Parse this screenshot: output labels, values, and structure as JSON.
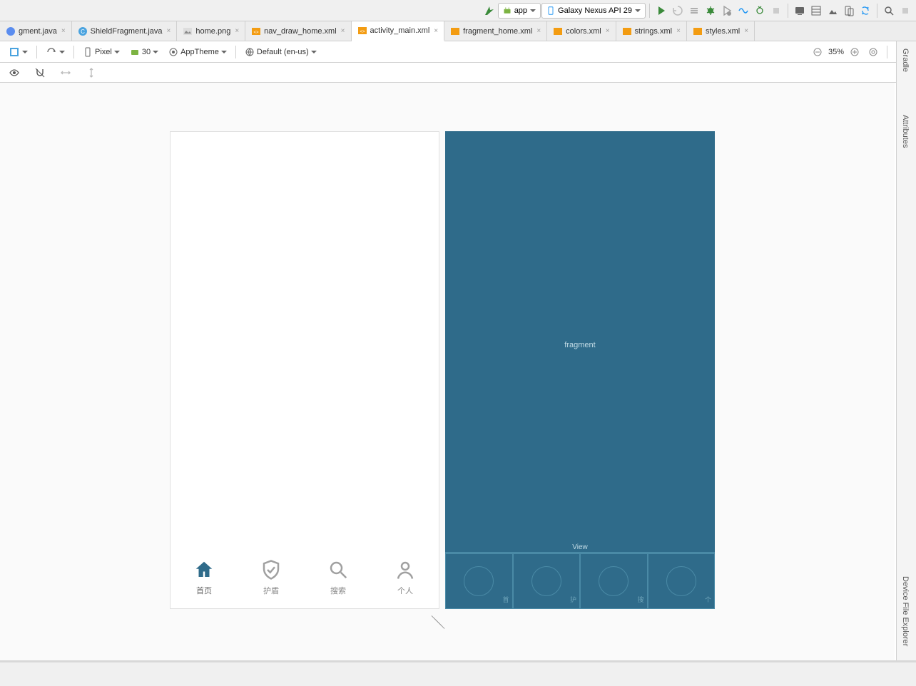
{
  "toolbar": {
    "app_label": "app",
    "device_label": "Galaxy Nexus API 29"
  },
  "tabs": [
    {
      "label": "gment.java",
      "icon": "java"
    },
    {
      "label": "ShieldFragment.java",
      "icon": "class"
    },
    {
      "label": "home.png",
      "icon": "image"
    },
    {
      "label": "nav_draw_home.xml",
      "icon": "xml"
    },
    {
      "label": "activity_main.xml",
      "icon": "xml",
      "active": true
    },
    {
      "label": "fragment_home.xml",
      "icon": "xml"
    },
    {
      "label": "colors.xml",
      "icon": "xml"
    },
    {
      "label": "strings.xml",
      "icon": "xml"
    },
    {
      "label": "styles.xml",
      "icon": "xml"
    }
  ],
  "editor_bar": {
    "device": "Pixel",
    "api": "30",
    "theme": "AppTheme",
    "locale": "Default (en-us)",
    "zoom": "35%"
  },
  "design": {
    "nav": [
      {
        "label": "首页",
        "icon": "home",
        "active": true
      },
      {
        "label": "护盾",
        "icon": "shield"
      },
      {
        "label": "搜索",
        "icon": "search"
      },
      {
        "label": "个人",
        "icon": "person"
      }
    ]
  },
  "blueprint": {
    "fragment_label": "fragment",
    "view_label": "View",
    "nav": [
      {
        "label": "首"
      },
      {
        "label": "护"
      },
      {
        "label": "搜"
      },
      {
        "label": "个"
      }
    ]
  },
  "right_tabs": [
    "Gradle",
    "Attributes",
    "Device File Explorer"
  ]
}
